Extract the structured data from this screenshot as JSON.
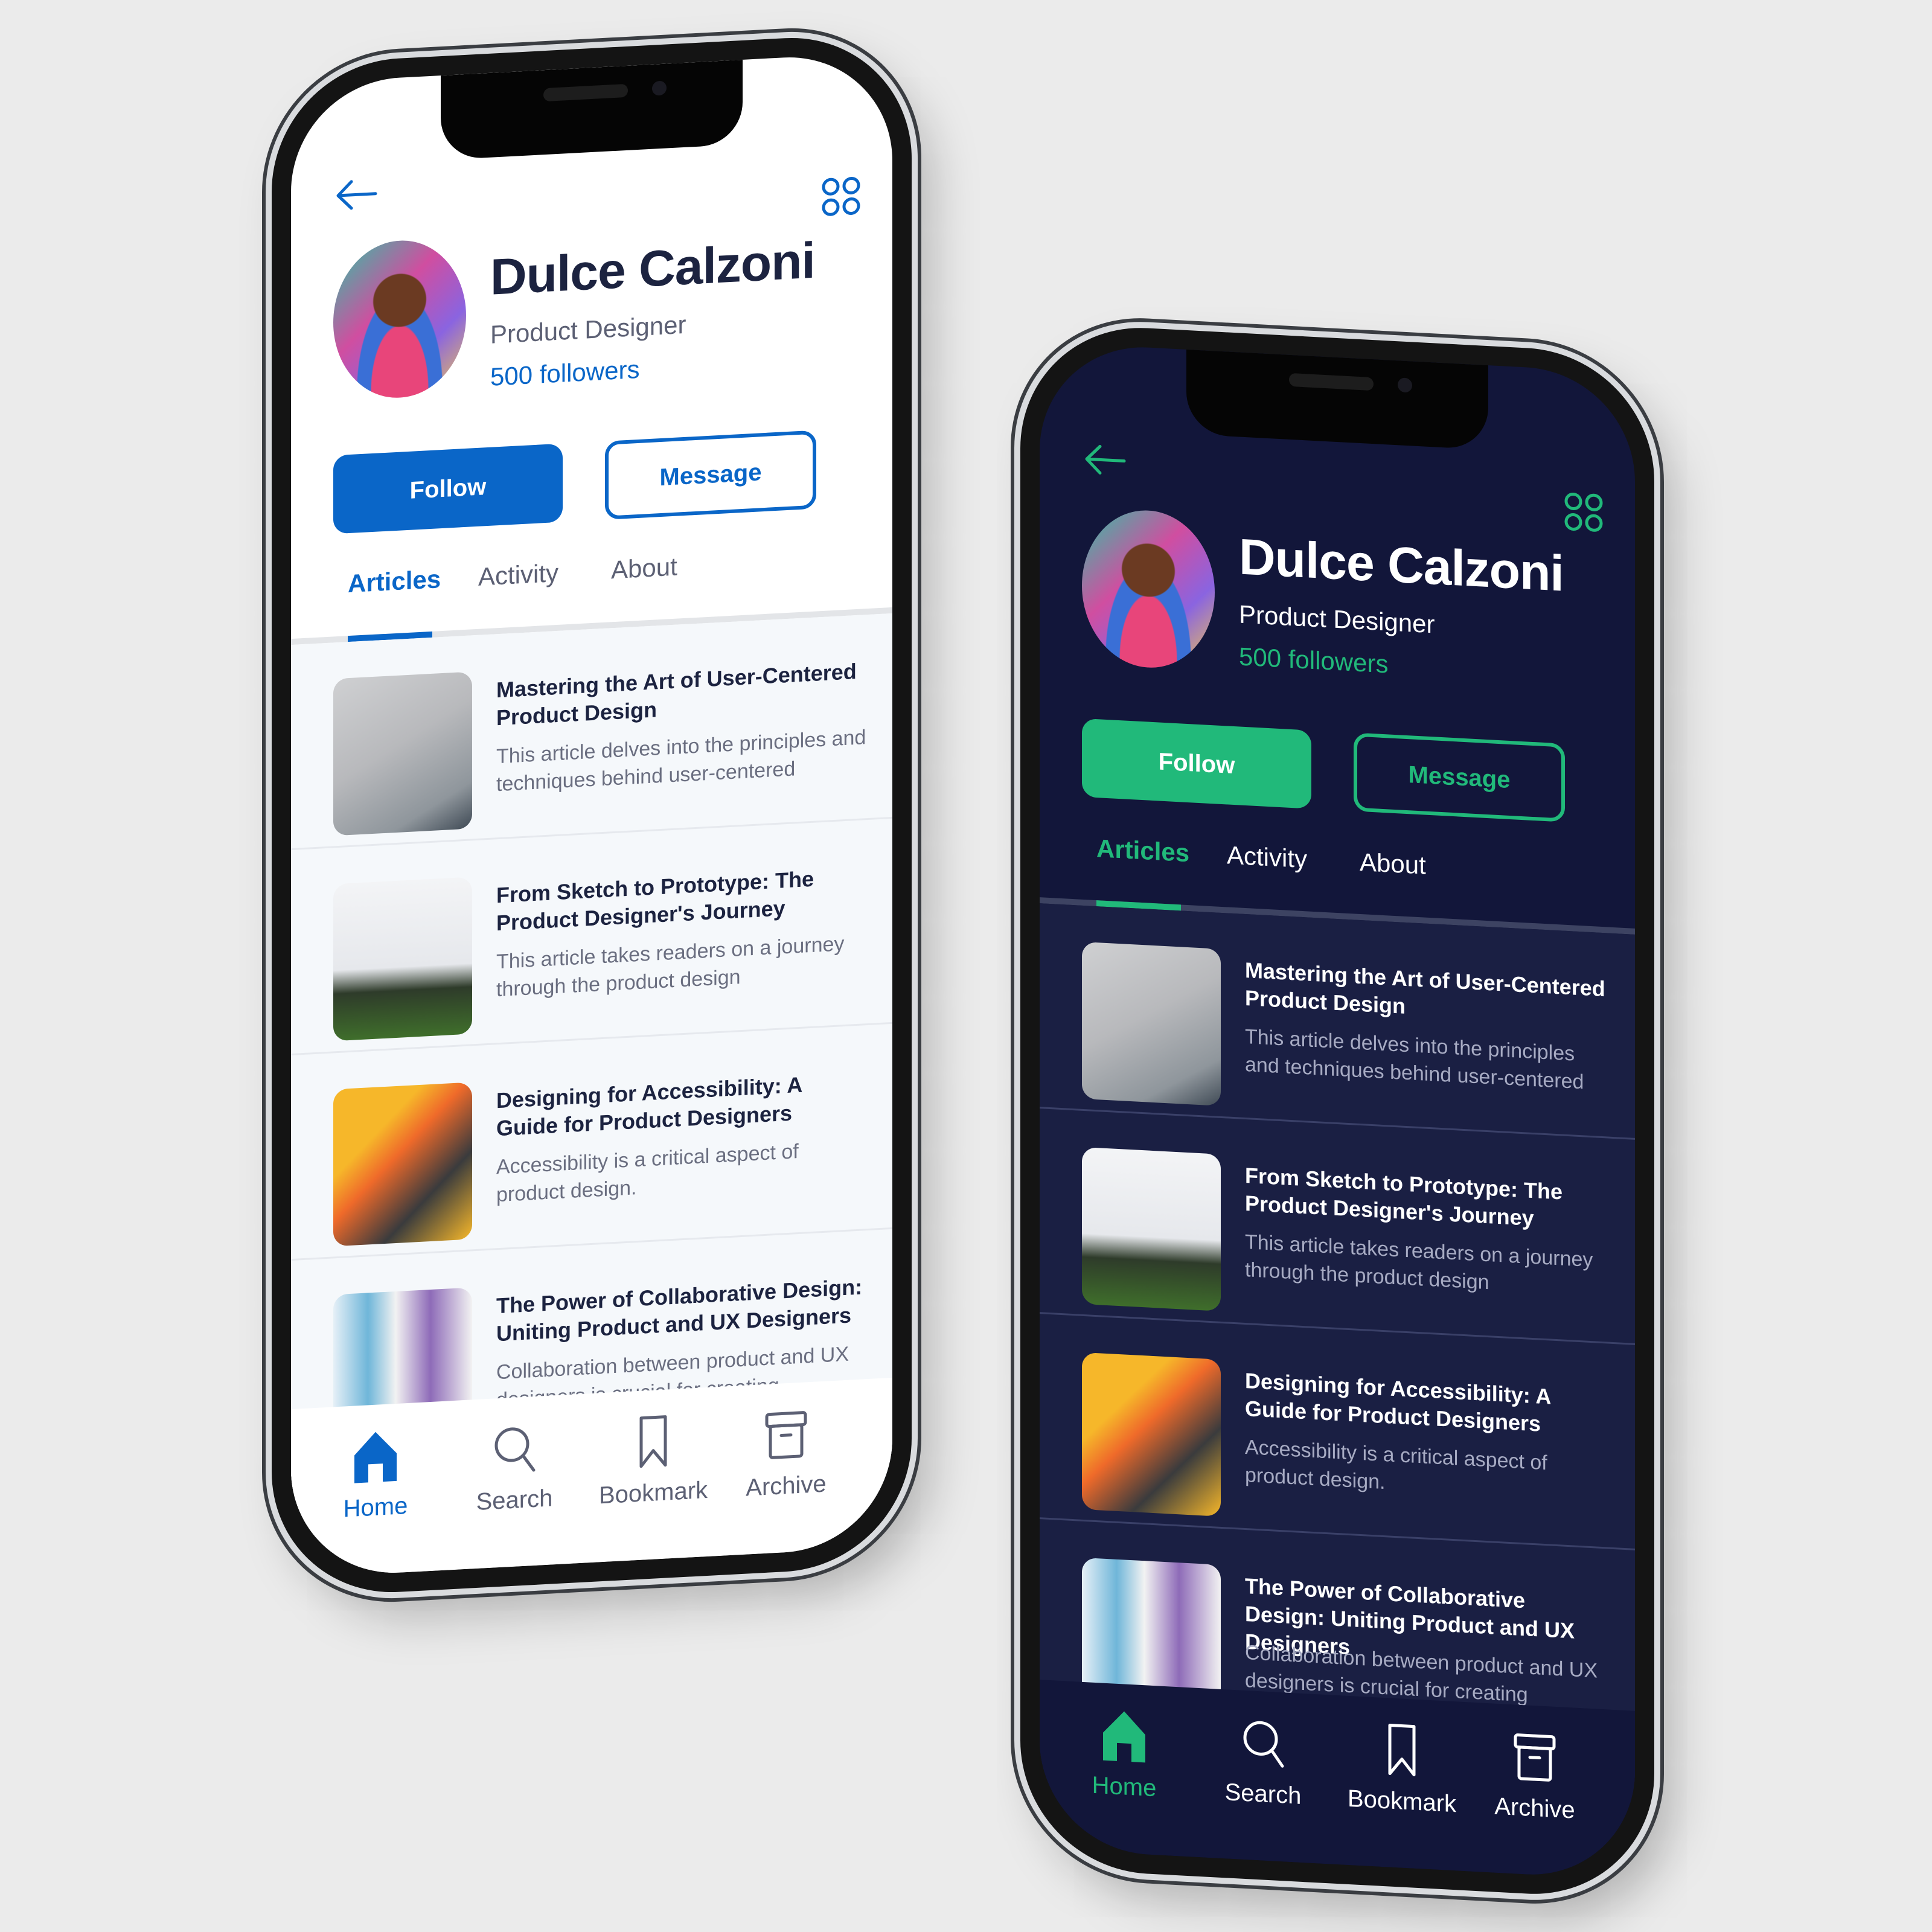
{
  "colors": {
    "light_accent": "#0a66c8",
    "dark_accent": "#21b97a",
    "dark_background": "#12163a"
  },
  "profile": {
    "name": "Dulce Calzoni",
    "role": "Product Designer",
    "followers": "500 followers"
  },
  "actions": {
    "follow_label": "Follow",
    "message_label": "Message"
  },
  "icons": {
    "back": "arrow-left-icon",
    "menu": "four-circles-grid-icon"
  },
  "tabs": [
    {
      "label": "Articles",
      "active": true
    },
    {
      "label": "Activity",
      "active": false
    },
    {
      "label": "About",
      "active": false
    }
  ],
  "articles": [
    {
      "title": "Mastering the Art of User-Centered Product Design",
      "description": "This article delves into the principles and techniques behind user-centered",
      "thumbnail": "sketchbook-pencil-photo"
    },
    {
      "title": "From Sketch to Prototype: The Product Designer's Journey",
      "description": "This article takes readers on a journey through the product design",
      "thumbnail": "monitor-with-plant-photo"
    },
    {
      "title": "Designing for Accessibility: A Guide for Product Designers",
      "description": "Accessibility is a critical aspect of product design.",
      "thumbnail": "change-by-design-book-photo"
    },
    {
      "title": "The Power of Collaborative Design: Uniting Product and UX Designers",
      "description": "Collaboration between product and UX designers is crucial for creating",
      "thumbnail": "wireframe-sketches-photo"
    }
  ],
  "nav": [
    {
      "label": "Home",
      "icon": "home-icon",
      "active": true
    },
    {
      "label": "Search",
      "icon": "search-icon",
      "active": false
    },
    {
      "label": "Bookmark",
      "icon": "bookmark-icon",
      "active": false
    },
    {
      "label": "Archive",
      "icon": "archive-icon",
      "active": false
    }
  ]
}
